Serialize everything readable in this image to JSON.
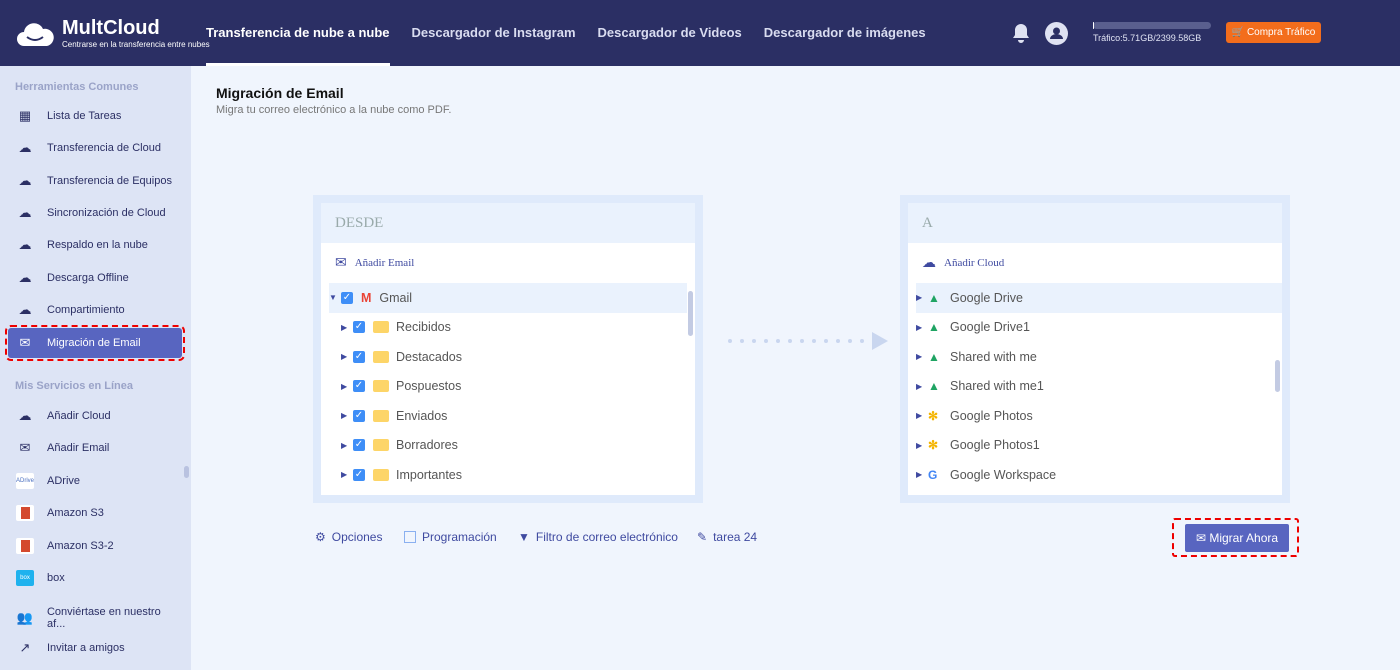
{
  "header": {
    "brand": "MultCloud",
    "tagline": "Centrarse en la transferencia entre nubes",
    "nav": [
      "Transferencia de nube a nube",
      "Descargador de Instagram",
      "Descargador de Videos",
      "Descargador de imágenes"
    ],
    "traffic": "Tráfico:5.71GB/2399.58GB",
    "traffic_used_fraction": 0.0024,
    "buy": "Compra Tráfico"
  },
  "sidebar": {
    "section1": "Herramientas Comunes",
    "tools": [
      "Lista de Tareas",
      "Transferencia de Cloud",
      "Transferencia de Equipos",
      "Sincronización de Cloud",
      "Respaldo en la nube",
      "Descarga Offline",
      "Compartimiento",
      "Migración de Email"
    ],
    "section2": "Mis Servicios en Línea",
    "services": [
      "Añadir Cloud",
      "Añadir Email",
      "ADrive",
      "Amazon S3",
      "Amazon S3-2",
      "box"
    ],
    "footer": [
      "Conviértase en nuestro af...",
      "Invitar a amigos"
    ],
    "adrive_logo": "ADrive",
    "box_logo": "box"
  },
  "main": {
    "title": "Migración de Email",
    "subtitle": "Migra tu correo electrónico a la nube como PDF.",
    "from": {
      "heading": "DESDE",
      "add": "Añadir Email",
      "root": "Gmail",
      "folders": [
        "Recibidos",
        "Destacados",
        "Pospuestos",
        "Enviados",
        "Borradores",
        "Importantes"
      ]
    },
    "to": {
      "heading": "A",
      "add": "Añadir Cloud",
      "clouds": [
        "Google Drive",
        "Google Drive1",
        "Shared with me",
        "Shared with me1",
        "Google Photos",
        "Google Photos1",
        "Google Workspace"
      ]
    },
    "options": "Opciones",
    "schedule": "Programación",
    "filter": "Filtro de correo electrónico",
    "task": "tarea 24",
    "migrate": "Migrar Ahora"
  },
  "colors": {
    "header": "#2b2f64",
    "accent": "#5865c0",
    "orange": "#f36d1c"
  }
}
